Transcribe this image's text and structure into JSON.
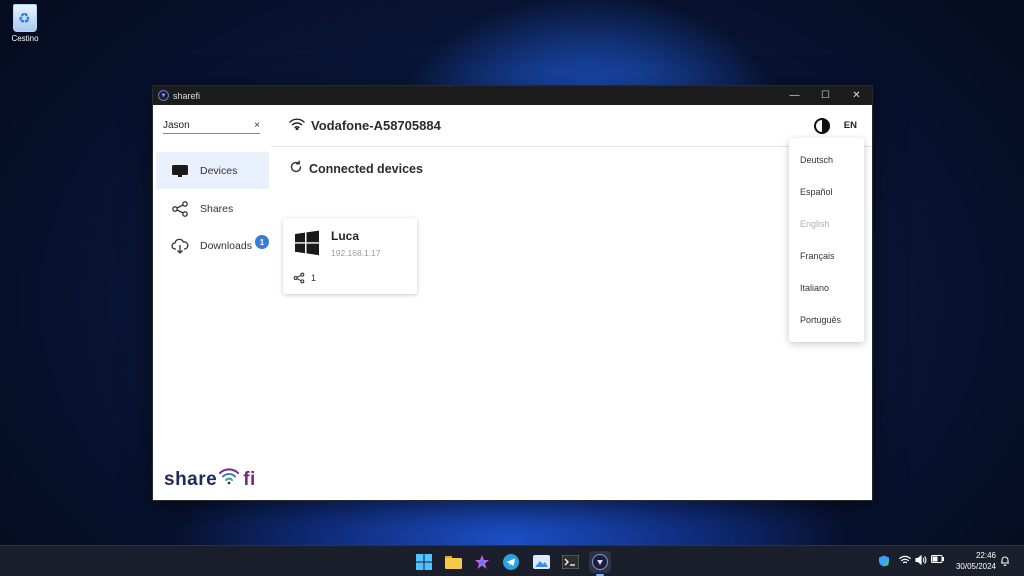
{
  "desktop": {
    "recycle_bin_label": "Cestino"
  },
  "window": {
    "title": "sharefi",
    "controls": {
      "minimize": "—",
      "maximize": "☐",
      "close": "✕"
    }
  },
  "sidebar": {
    "search": {
      "value": "Jason",
      "clear": "×"
    },
    "items": [
      {
        "label": "Devices",
        "icon": "monitor-icon",
        "active": true
      },
      {
        "label": "Shares",
        "icon": "share-icon"
      },
      {
        "label": "Downloads",
        "icon": "cloud-download-icon",
        "badge": "1"
      }
    ],
    "brand": {
      "part1": "share",
      "part2": "fi"
    }
  },
  "header": {
    "ssid": "Vodafone-A58705884",
    "language": "EN"
  },
  "main": {
    "section_title": "Connected devices",
    "devices": [
      {
        "name": "Luca",
        "ip": "192.168.1.17",
        "shares": "1",
        "os_icon": "windows-icon"
      }
    ]
  },
  "language_menu": {
    "items": [
      {
        "label": "Deutsch"
      },
      {
        "label": "Español"
      },
      {
        "label": "English",
        "disabled": true
      },
      {
        "label": "Français"
      },
      {
        "label": "Italiano"
      },
      {
        "label": "Português"
      }
    ]
  },
  "taskbar": {
    "clock": {
      "time": "22:46",
      "date": "30/05/2024"
    },
    "apps": [
      "start-icon",
      "file-explorer-icon",
      "copilot-icon",
      "telegram-icon",
      "photos-icon",
      "terminal-icon",
      "sharefi-icon"
    ]
  },
  "colors": {
    "accent": "#3a7bd5",
    "brand_dark": "#1e2a5a",
    "brand_purple": "#7a2a7a",
    "active_nav": "#e8f0fb"
  }
}
